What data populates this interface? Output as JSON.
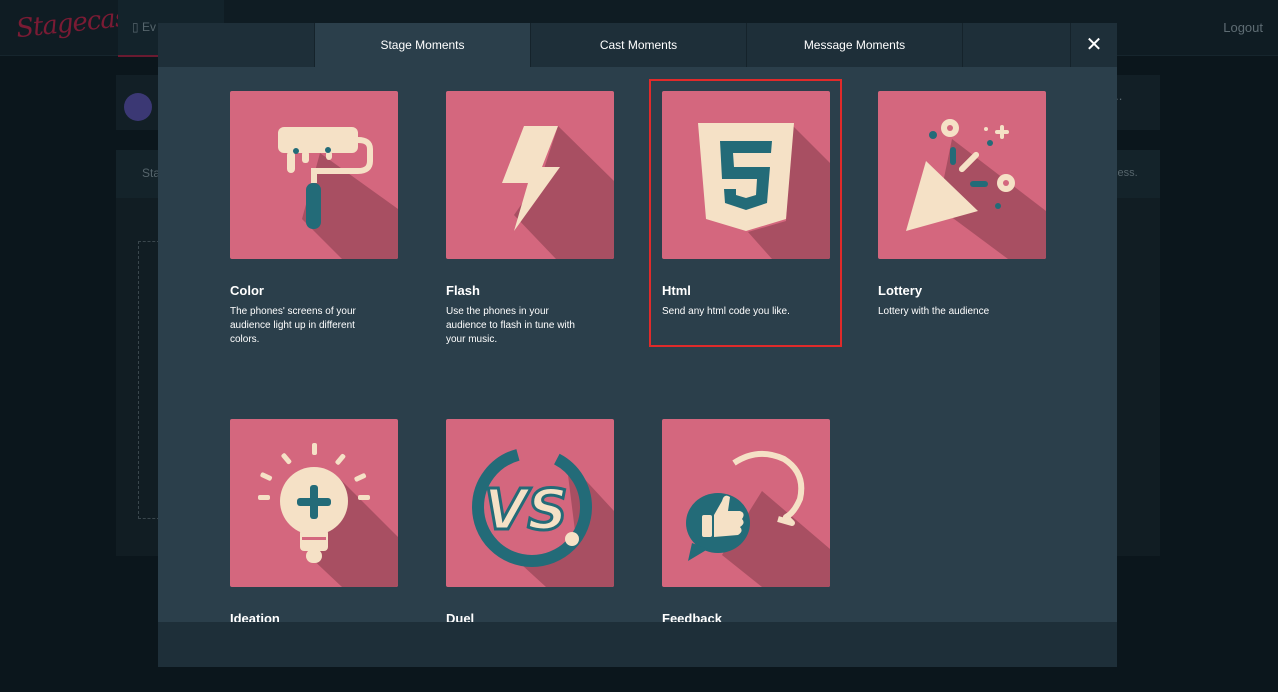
{
  "app": {
    "logo_text": "Stagecast",
    "nav_tab_label": "Ev",
    "logout_label": "Logout"
  },
  "background": {
    "title_fragment": "t (...",
    "strip_label": "Sta",
    "strip_right": "cess."
  },
  "modal": {
    "tabs": [
      {
        "label": "Stage Moments",
        "active": true
      },
      {
        "label": "Cast Moments",
        "active": false
      },
      {
        "label": "Message Moments",
        "active": false
      }
    ],
    "close_label": "✕",
    "tiles": [
      {
        "title": "Color",
        "desc": "The phones' screens of your audience light up in different colors.",
        "icon": "paint-roller-icon"
      },
      {
        "title": "Flash",
        "desc": "Use the phones in your audience to flash in tune with your music.",
        "icon": "lightning-icon"
      },
      {
        "title": "Html",
        "desc": "Send any html code you like.",
        "icon": "html5-icon",
        "selected": true
      },
      {
        "title": "Lottery",
        "desc": "Lottery with the audience",
        "icon": "party-popper-icon"
      },
      {
        "title": "Ideation",
        "desc": "",
        "icon": "lightbulb-icon"
      },
      {
        "title": "Duel",
        "desc": "",
        "icon": "versus-icon"
      },
      {
        "title": "Feedback",
        "desc": "",
        "icon": "thumbs-up-chat-icon"
      }
    ]
  },
  "colors": {
    "tile_bg": "#d4677e",
    "cream": "#f5e1c6",
    "teal": "#236b78",
    "selection": "#e02a2a"
  }
}
